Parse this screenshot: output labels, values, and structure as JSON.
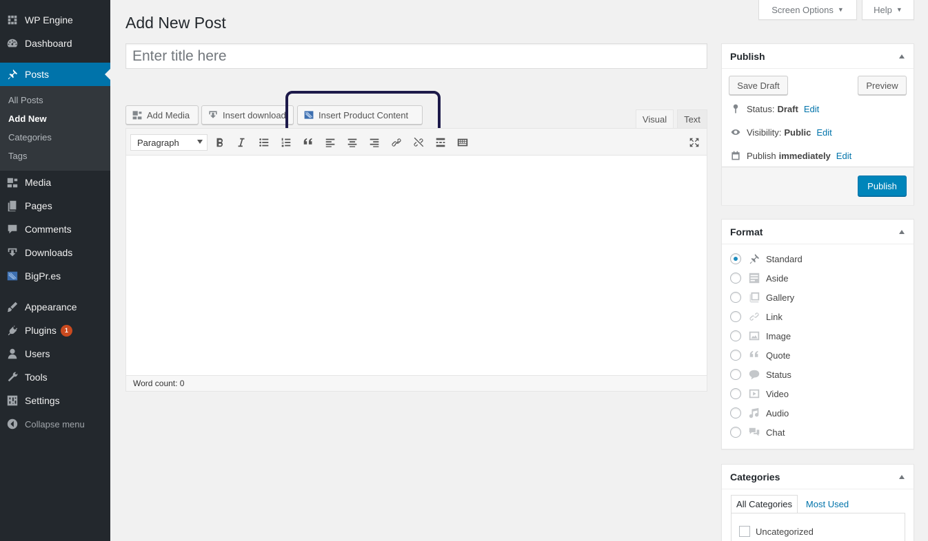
{
  "sidebar": {
    "items": [
      {
        "label": "WP Engine",
        "icon": "wp-engine-icon"
      },
      {
        "label": "Dashboard",
        "icon": "dashboard-icon"
      },
      {
        "label": "Posts",
        "icon": "pin-icon"
      },
      {
        "label": "Media",
        "icon": "media-icon"
      },
      {
        "label": "Pages",
        "icon": "pages-icon"
      },
      {
        "label": "Comments",
        "icon": "comments-icon"
      },
      {
        "label": "Downloads",
        "icon": "downloads-icon"
      },
      {
        "label": "BigPr.es",
        "icon": "bigpres-icon"
      },
      {
        "label": "Appearance",
        "icon": "appearance-icon"
      },
      {
        "label": "Plugins",
        "icon": "plugins-icon",
        "badge": "1"
      },
      {
        "label": "Users",
        "icon": "users-icon"
      },
      {
        "label": "Tools",
        "icon": "tools-icon"
      },
      {
        "label": "Settings",
        "icon": "settings-icon"
      }
    ],
    "submenu": [
      "All Posts",
      "Add New",
      "Categories",
      "Tags"
    ],
    "collapse": "Collapse menu"
  },
  "top": {
    "screen_options": "Screen Options",
    "help": "Help"
  },
  "page_title": "Add New Post",
  "title_placeholder": "Enter title here",
  "media_buttons": {
    "add_media": "Add Media",
    "insert_download": "Insert download",
    "insert_product": "Insert Product Content"
  },
  "editor": {
    "tab_visual": "Visual",
    "tab_text": "Text",
    "format_select": "Paragraph",
    "word_count": "Word count: 0"
  },
  "publish": {
    "title": "Publish",
    "save_draft": "Save Draft",
    "preview": "Preview",
    "status_label": "Status:",
    "status_value": "Draft",
    "visibility_label": "Visibility:",
    "visibility_value": "Public",
    "publish_label": "Publish",
    "publish_value": "immediately",
    "edit": "Edit",
    "publish_button": "Publish"
  },
  "format": {
    "title": "Format",
    "options": [
      "Standard",
      "Aside",
      "Gallery",
      "Link",
      "Image",
      "Quote",
      "Status",
      "Video",
      "Audio",
      "Chat"
    ],
    "selected": "Standard"
  },
  "categories": {
    "title": "Categories",
    "tab_all": "All Categories",
    "tab_most_used": "Most Used",
    "items": [
      "Uncategorized"
    ]
  },
  "colors": {
    "accent": "#0073aa",
    "sidebar": "#23282d",
    "publish": "#0085ba",
    "highlight": "#1d1a4a",
    "badge": "#ca4a1f"
  }
}
